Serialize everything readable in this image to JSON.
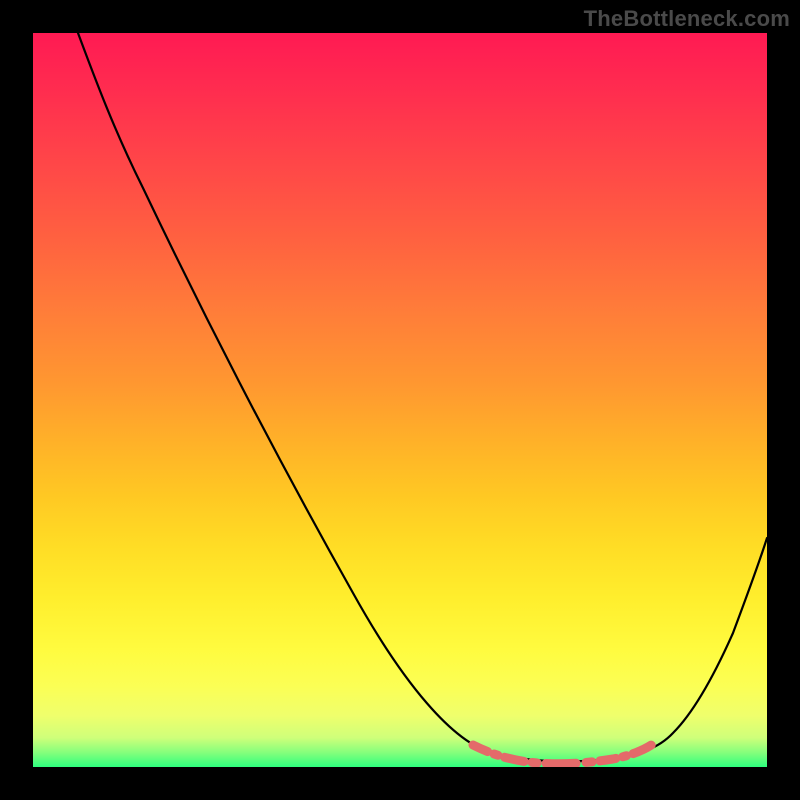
{
  "watermark": "TheBottleneck.com",
  "chart_data": {
    "type": "line",
    "title": "",
    "xlabel": "",
    "ylabel": "",
    "xlim": [
      0,
      100
    ],
    "ylim": [
      0,
      100
    ],
    "grid": false,
    "legend": false,
    "background": "rainbow-vertical-gradient (red top → green bottom)",
    "series": [
      {
        "name": "bottleneck-curve",
        "x": [
          0,
          5,
          10,
          15,
          20,
          25,
          30,
          35,
          40,
          45,
          50,
          55,
          60,
          62,
          65,
          68,
          72,
          76,
          80,
          83,
          86,
          90,
          93,
          96,
          100
        ],
        "values": [
          100,
          92,
          85,
          78,
          72,
          65,
          58,
          51,
          44,
          37,
          30,
          23,
          15,
          11,
          7,
          5,
          4,
          4,
          5,
          5,
          6,
          10,
          15,
          21,
          30
        ]
      }
    ],
    "highlight": {
      "name": "optimal-range-markers",
      "color": "#e46a6a",
      "x": [
        62,
        65,
        68,
        70,
        72,
        74,
        76,
        78,
        80,
        82,
        84
      ],
      "values": [
        11,
        7,
        5,
        4,
        4,
        4,
        4,
        5,
        5,
        5,
        5
      ]
    }
  }
}
